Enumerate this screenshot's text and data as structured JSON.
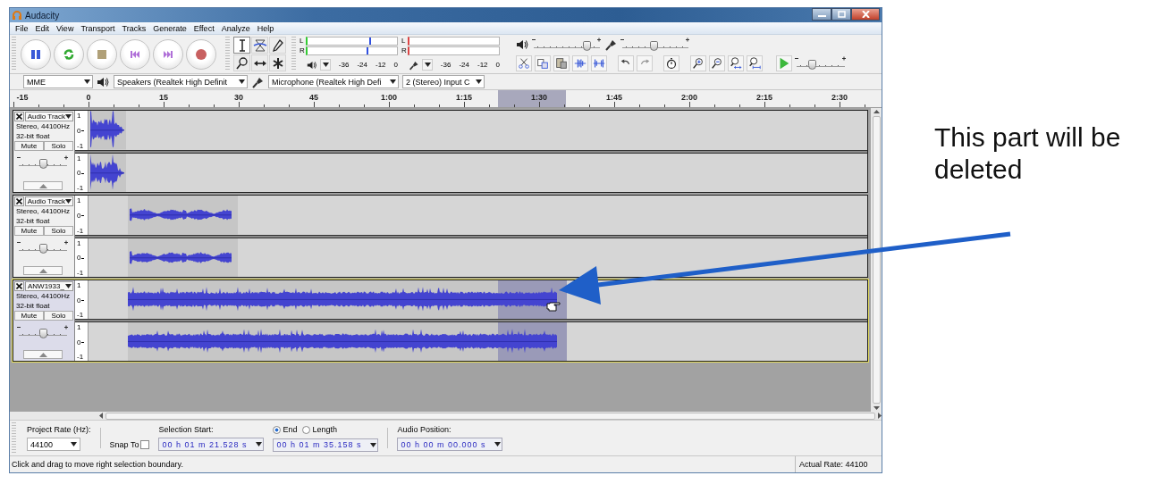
{
  "window": {
    "title": "Audacity"
  },
  "menu": [
    "File",
    "Edit",
    "View",
    "Transport",
    "Tracks",
    "Generate",
    "Effect",
    "Analyze",
    "Help"
  ],
  "tools": [
    {
      "kind": "select",
      "selected": true
    },
    {
      "kind": "envelope",
      "selected": false
    },
    {
      "kind": "draw",
      "selected": false
    },
    {
      "kind": "zoom",
      "selected": false
    },
    {
      "kind": "timeshift",
      "selected": false
    },
    {
      "kind": "multi",
      "selected": false
    }
  ],
  "meters": [
    {
      "kind": "playback",
      "channels": [
        {
          "label": "L",
          "level": 0.69
        },
        {
          "label": "R",
          "level": 0.66
        }
      ],
      "scale": [
        "-36",
        "-24",
        "-12",
        "0"
      ]
    },
    {
      "kind": "recording",
      "channels": [
        {
          "label": "L"
        },
        {
          "label": "R"
        }
      ],
      "scale": [
        "-36",
        "-24",
        "-12",
        "0"
      ]
    }
  ],
  "mixer": {
    "output": {
      "level": 0.8
    },
    "input": {
      "level": 0.47
    }
  },
  "play_at_speed": {
    "level": 0.3
  },
  "devices": {
    "host": "MME",
    "output": "Speakers (Realtek High Definit",
    "input": "Microphone (Realtek High Defi",
    "input_channels": "2 (Stereo) Input C"
  },
  "ruler": {
    "ticks": [
      "-15",
      "0",
      "15",
      "30",
      "45",
      "1:00",
      "1:15",
      "1:30",
      "1:45",
      "2:00",
      "2:15",
      "2:30"
    ]
  },
  "tracks": [
    {
      "name": "Audio Track",
      "format": "Stereo, 44100Hz",
      "sample_format": "32-bit float",
      "selected": false,
      "mute": "Mute",
      "solo": "Solo",
      "gain": {
        "level": 0.5
      },
      "channels": [
        {
          "scale": [
            "1",
            "0",
            "-1"
          ]
        },
        {
          "scale": [
            "1",
            "0",
            "-1"
          ]
        }
      ]
    },
    {
      "name": "Audio Track",
      "format": "Stereo, 44100Hz",
      "sample_format": "32-bit float",
      "selected": false,
      "mute": "Mute",
      "solo": "Solo",
      "gain": {
        "level": 0.5
      },
      "channels": [
        {
          "scale": [
            "1",
            "0",
            "-1"
          ]
        },
        {
          "scale": [
            "1",
            "0",
            "-1"
          ]
        }
      ]
    },
    {
      "name": "ANW1933_",
      "format": "Stereo, 44100Hz",
      "sample_format": "32-bit float",
      "selected": true,
      "mute": "Mute",
      "solo": "Solo",
      "gain": {
        "level": 0.5
      },
      "channels": [
        {
          "scale": [
            "1",
            "0",
            "-1"
          ]
        },
        {
          "scale": [
            "1",
            "0",
            "-1"
          ]
        }
      ]
    }
  ],
  "selection_toolbar": {
    "project_rate_label": "Project Rate (Hz):",
    "project_rate": "44100",
    "snap_to": {
      "label": "Snap To",
      "checked": false
    },
    "selection_start_label": "Selection Start:",
    "selection_start": "00 h 01 m 21.528 s",
    "end_modes": [
      {
        "label": "End",
        "selected": true
      },
      {
        "label": "Length",
        "selected": false
      }
    ],
    "selection_end": "00 h 01 m 35.158 s",
    "audio_position_label": "Audio Position:",
    "audio_position": "00 h 00 m 00.000 s"
  },
  "status_bar": {
    "message": "Click and drag to move right selection boundary.",
    "rate": "Actual Rate: 44100"
  },
  "annotation": {
    "text": "This part will be deleted"
  }
}
